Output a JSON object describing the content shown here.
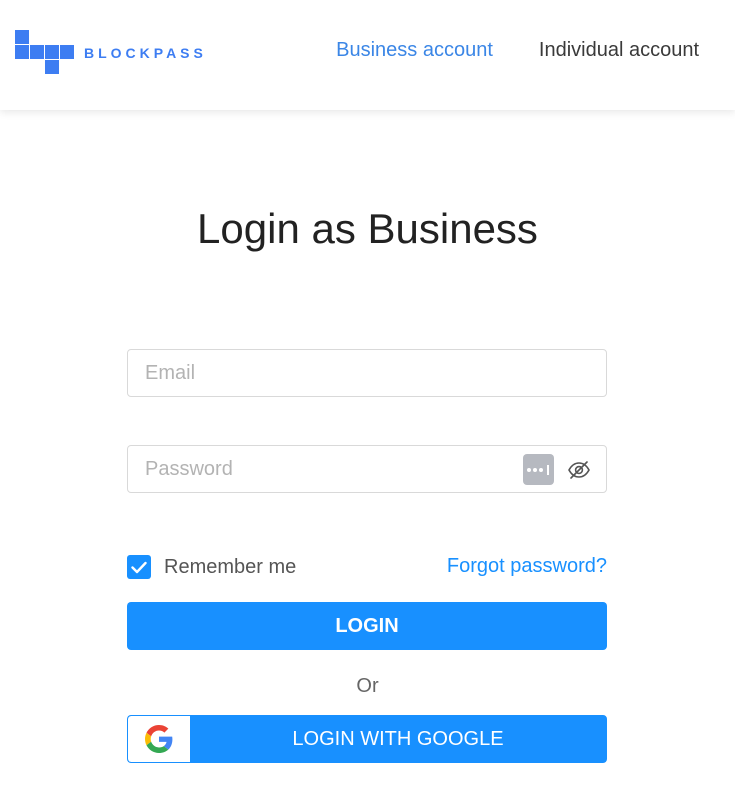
{
  "header": {
    "logo_text": "BLOCKPASS",
    "nav": [
      {
        "label": "Business account",
        "active": true
      },
      {
        "label": "Individual account",
        "active": false
      }
    ]
  },
  "main": {
    "title": "Login as Business",
    "email": {
      "placeholder": "Email",
      "value": ""
    },
    "password": {
      "placeholder": "Password",
      "value": ""
    },
    "remember": {
      "label": "Remember me",
      "checked": true
    },
    "forgot_label": "Forgot password?",
    "login_label": "LOGIN",
    "or_label": "Or",
    "google_label": "LOGIN WITH GOOGLE"
  },
  "icons": {
    "logo": "blockpass-logo-mark",
    "password_manager": "password-manager-icon",
    "eye_toggle": "eye-slash-icon",
    "checkbox": "check-icon",
    "google": "google-g-icon"
  },
  "colors": {
    "brand": "#3d7df2",
    "primary": "#1890ff",
    "active_nav": "#3b86e6"
  }
}
